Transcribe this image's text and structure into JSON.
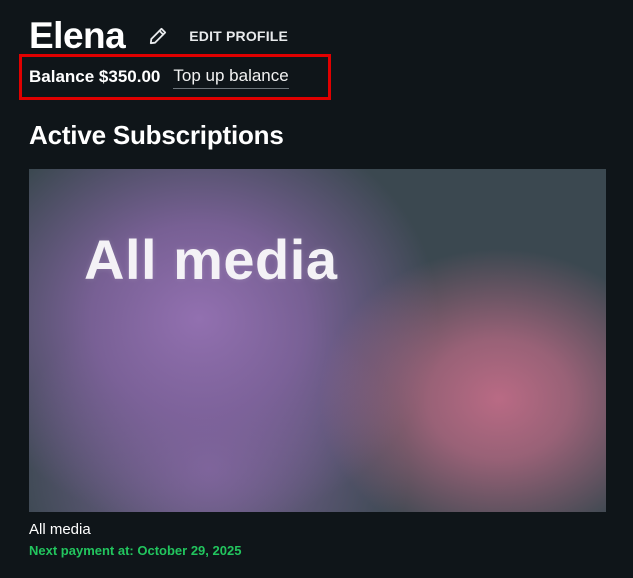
{
  "profile": {
    "name": "Elena",
    "edit_label": "EDIT PROFILE"
  },
  "balance": {
    "text": "Balance $350.00",
    "topup_label": "Top up balance"
  },
  "subscriptions": {
    "section_title": "Active Subscriptions",
    "items": [
      {
        "card_title": "All media",
        "name": "All media",
        "next_payment": "Next payment at: October 29, 2025"
      }
    ]
  },
  "colors": {
    "background": "#0f1519",
    "highlight_border": "#e00000",
    "payment_green": "#22c55e"
  },
  "icons": {
    "edit": "pencil-icon"
  }
}
